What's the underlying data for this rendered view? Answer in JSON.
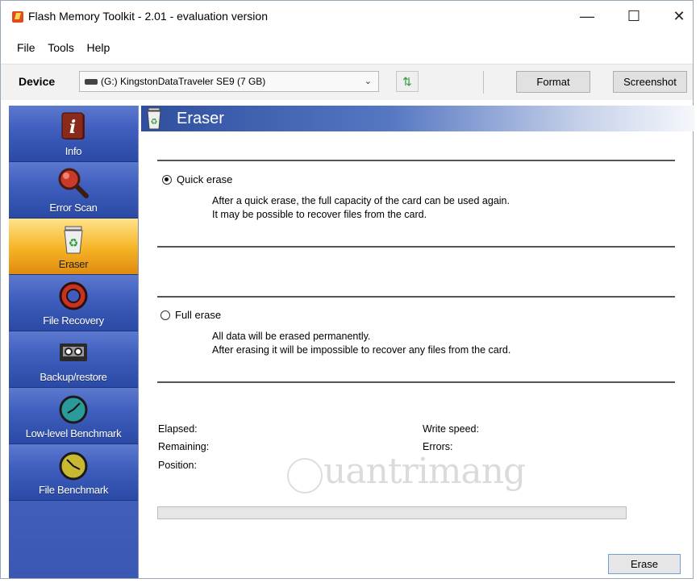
{
  "window": {
    "title": "Flash Memory Toolkit - 2.01 - evaluation version",
    "controls": {
      "minimize": "—",
      "maximize": "☐",
      "close": "✕"
    }
  },
  "menu": [
    "File",
    "Tools",
    "Help"
  ],
  "toolbar": {
    "device_label": "Device",
    "device_value": "(G:) KingstonDataTraveler SE9 (7 GB)",
    "format_label": "Format",
    "screenshot_label": "Screenshot"
  },
  "sidebar": {
    "items": [
      {
        "label": "Info",
        "icon": "info-icon"
      },
      {
        "label": "Error Scan",
        "icon": "magnifier-icon"
      },
      {
        "label": "Eraser",
        "icon": "recycle-bin-icon",
        "active": true
      },
      {
        "label": "File Recovery",
        "icon": "lifebuoy-icon"
      },
      {
        "label": "Backup/restore",
        "icon": "tape-icon"
      },
      {
        "label": "Low-level Benchmark",
        "icon": "stopwatch-icon"
      },
      {
        "label": "File Benchmark",
        "icon": "stopwatch-icon"
      }
    ]
  },
  "panel": {
    "title": "Eraser",
    "quick_erase": {
      "label": "Quick erase",
      "selected": true,
      "line1": "After a quick erase, the full capacity of the card can be used again.",
      "line2": "It may be possible to recover files from the card."
    },
    "full_erase": {
      "label": "Full erase",
      "selected": false,
      "line1": "All data will be erased permanently.",
      "line2": "After erasing it will be impossible to recover any files from the card."
    },
    "stats": {
      "elapsed": "Elapsed:",
      "remaining": "Remaining:",
      "position": "Position:",
      "write_speed": "Write speed:",
      "errors": "Errors:"
    },
    "progress": 0,
    "erase_label": "Erase"
  },
  "watermark": "uantrimang"
}
